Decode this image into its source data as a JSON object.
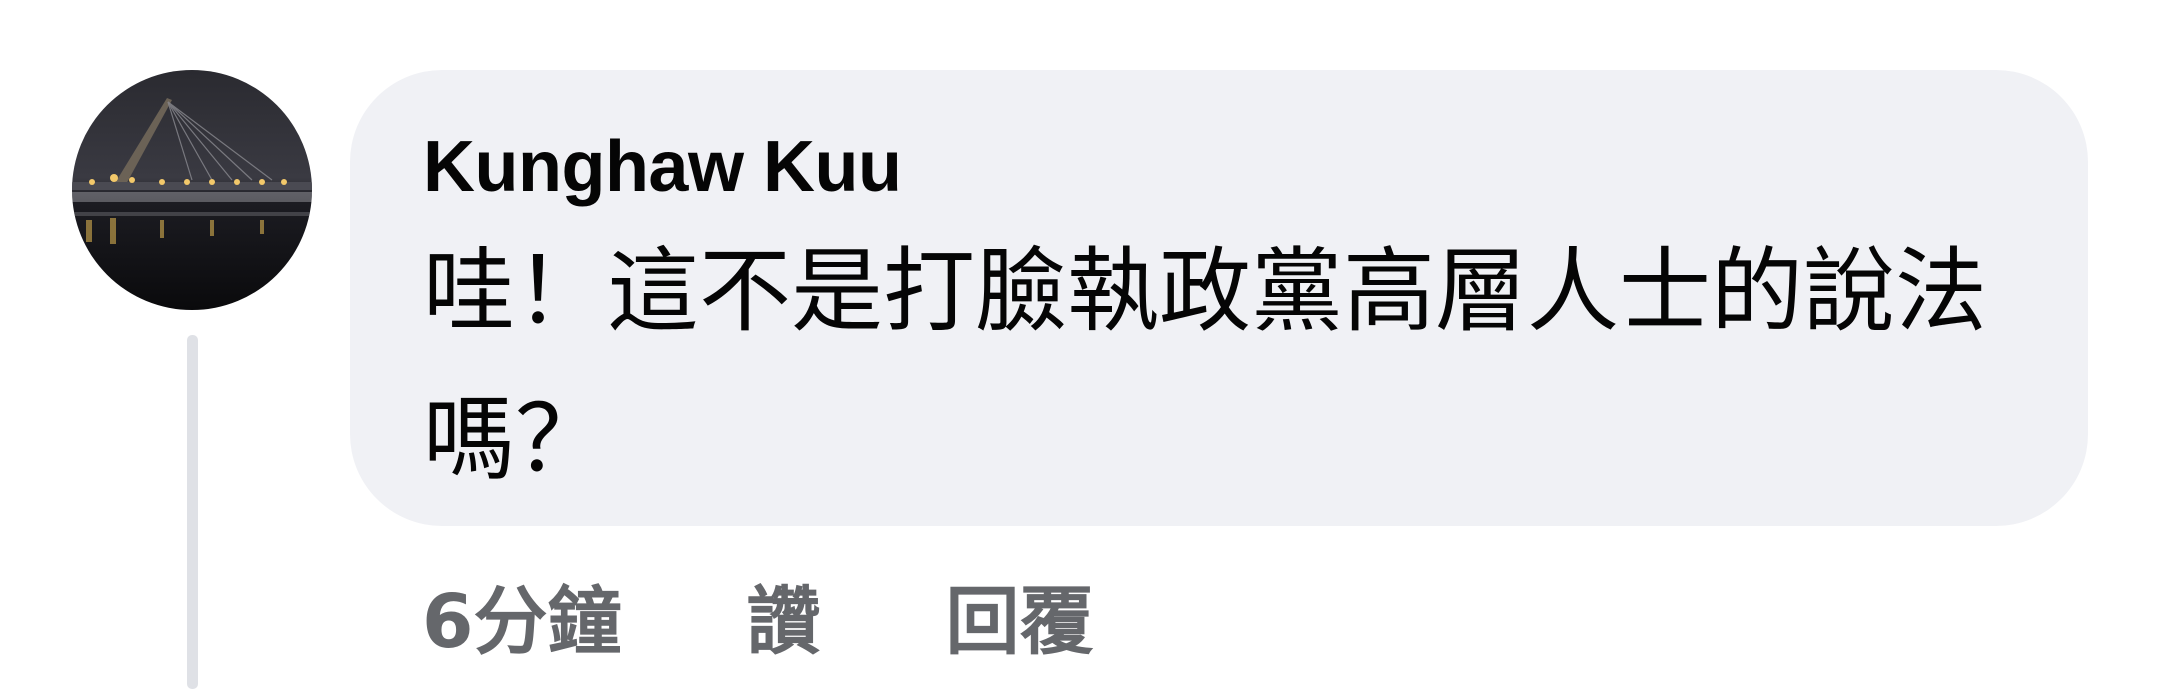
{
  "comment": {
    "author": "Kunghaw Kuu",
    "text": "哇！這不是打臉執政黨高層人士的說法嗎？",
    "avatar_icon": "night-bridge-photo-avatar"
  },
  "actions": {
    "time": "6分鐘",
    "like_label": "讚",
    "reply_label": "回覆"
  },
  "colors": {
    "bubble_bg": "#f0f1f5",
    "text": "#050505",
    "secondary_text": "#65676b",
    "thread_line": "#dfe1e6"
  }
}
